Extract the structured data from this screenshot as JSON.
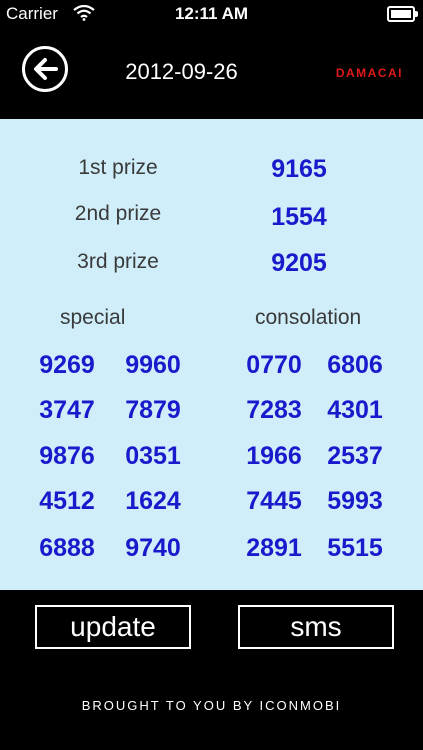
{
  "status_bar": {
    "carrier": "Carrier",
    "time": "12:11 AM"
  },
  "header": {
    "date": "2012-09-26",
    "brand": "DAMACAI",
    "back_icon": "back-arrow-icon"
  },
  "prizes": [
    {
      "label": "1st prize",
      "value": "9165"
    },
    {
      "label": "2nd prize",
      "value": "1554"
    },
    {
      "label": "3rd prize",
      "value": "9205"
    }
  ],
  "special": {
    "label": "special",
    "rows": [
      [
        "9269",
        "9960"
      ],
      [
        "3747",
        "7879"
      ],
      [
        "9876",
        "0351"
      ],
      [
        "4512",
        "1624"
      ],
      [
        "6888",
        "9740"
      ]
    ]
  },
  "consolation": {
    "label": "consolation",
    "rows": [
      [
        "0770",
        "6806"
      ],
      [
        "7283",
        "4301"
      ],
      [
        "1966",
        "2537"
      ],
      [
        "7445",
        "5993"
      ],
      [
        "2891",
        "5515"
      ]
    ]
  },
  "buttons": {
    "update": "update",
    "sms": "sms"
  },
  "footer": {
    "credit": "BROUGHT TO YOU BY ICONMOBI"
  },
  "colors": {
    "panel_bg": "#d0eef9",
    "number_blue": "#1a1acc",
    "brand_red": "#e01a1a"
  }
}
